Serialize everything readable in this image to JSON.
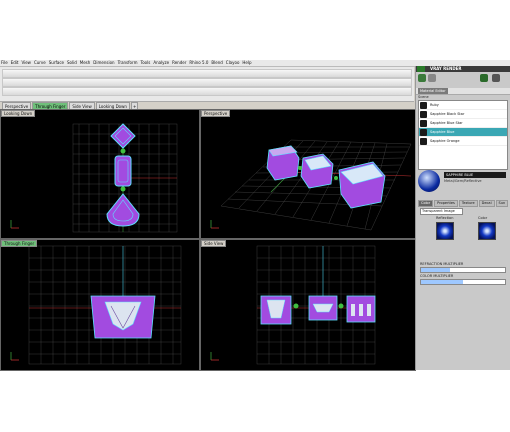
{
  "menu": [
    "File",
    "Edit",
    "View",
    "Curve",
    "Surface",
    "Solid",
    "Mesh",
    "Dimension",
    "Transform",
    "Tools",
    "Analyze",
    "Render",
    "Rhino 5.0",
    "Blend",
    "Clayoo",
    "Help"
  ],
  "tabs": [
    {
      "label": "Perspective",
      "active": false
    },
    {
      "label": "Through Finger",
      "active": true
    },
    {
      "label": "Side View",
      "active": false
    },
    {
      "label": "Looking Down",
      "active": false
    },
    {
      "label": "+",
      "active": false
    }
  ],
  "viewports": {
    "top_left": {
      "label": "Looking Down"
    },
    "top_right": {
      "label": "Perspective"
    },
    "bottom_left": {
      "label": "Through Finger"
    },
    "bottom_right": {
      "label": "Side View"
    }
  },
  "panel": {
    "title": "VRAY RENDER",
    "material_tab": "Material Editor",
    "scene_label": "Scene",
    "materials": [
      {
        "name": "Ruby",
        "selected": false
      },
      {
        "name": "Sapphire Black Star",
        "selected": false
      },
      {
        "name": "Sapphire Blue Star",
        "selected": false
      },
      {
        "name": "Sapphire Blue",
        "selected": true
      },
      {
        "name": "Sapphire Orange",
        "selected": false
      }
    ],
    "selected_name": "SAPPHIRE BLUE",
    "selected_type": "Metal/Gem/Reflective",
    "subtabs": [
      "Color",
      "Properties",
      "Texture",
      "Decal",
      "Sun"
    ],
    "dropdown": "Transparent Image",
    "tex_labels": [
      "Reflection",
      "Color"
    ],
    "sliders": [
      {
        "label": "REFRACTION MULTIPLIER",
        "value": 0.35
      },
      {
        "label": "COLOR MULTIPLIER",
        "value": 0.5
      }
    ]
  },
  "colors": {
    "accent": "#3aa7b4",
    "object": "#a24be0",
    "outline": "#5de0ff",
    "grid": "#5a5a5a"
  }
}
